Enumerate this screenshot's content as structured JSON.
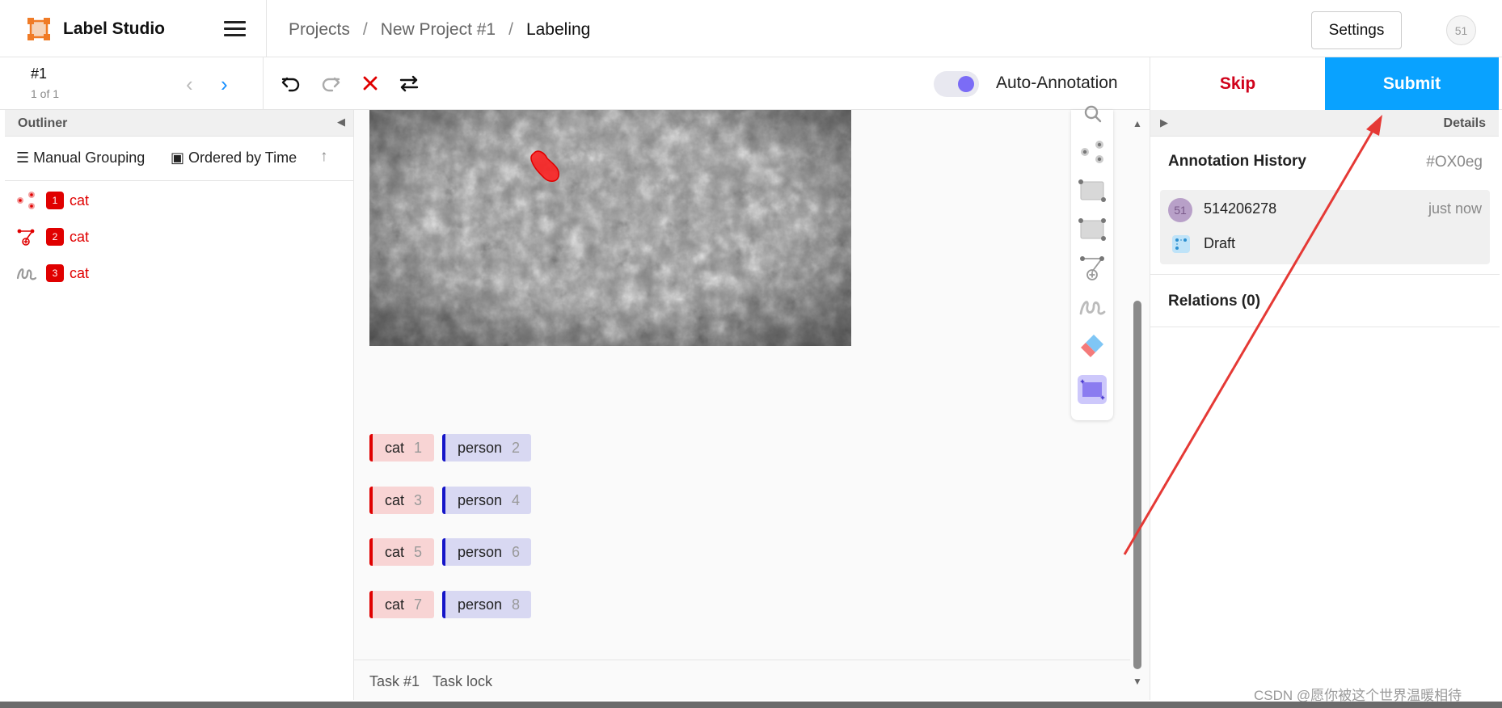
{
  "app": {
    "title": "Label Studio"
  },
  "breadcrumb": {
    "items": [
      "Projects",
      "New Project #1",
      "Labeling"
    ]
  },
  "header": {
    "settings_label": "Settings",
    "avatar_initials": "51"
  },
  "task": {
    "id": "#1",
    "count": "1 of 1"
  },
  "toolbar": {
    "auto_annotation_label": "Auto-Annotation",
    "auto_annotation_on": true
  },
  "actions": {
    "skip_label": "Skip",
    "submit_label": "Submit"
  },
  "outliner": {
    "title": "Outliner",
    "grouping_label": "Manual Grouping",
    "ordering_label": "Ordered by Time",
    "regions": [
      {
        "index": "1",
        "label": "cat",
        "icon": "keypoint-icon"
      },
      {
        "index": "2",
        "label": "cat",
        "icon": "polygon-icon"
      },
      {
        "index": "3",
        "label": "cat",
        "icon": "brush-icon"
      }
    ]
  },
  "labels": [
    {
      "name": "cat",
      "hotkey": "1"
    },
    {
      "name": "person",
      "hotkey": "2"
    },
    {
      "name": "cat",
      "hotkey": "3"
    },
    {
      "name": "person",
      "hotkey": "4"
    },
    {
      "name": "cat",
      "hotkey": "5"
    },
    {
      "name": "person",
      "hotkey": "6"
    },
    {
      "name": "cat",
      "hotkey": "7"
    },
    {
      "name": "person",
      "hotkey": "8"
    }
  ],
  "footer": {
    "task_label": "Task #1",
    "lock_label": "Task lock"
  },
  "details": {
    "title": "Details",
    "history_title": "Annotation History",
    "history_id": "#OX0eg",
    "entry": {
      "avatar": "51",
      "user": "514206278",
      "time": "just now",
      "status": "Draft"
    },
    "relations_label": "Relations (0)"
  },
  "watermark": "CSDN @愿你被这个世界温暖相待",
  "colors": {
    "accent": "#09a2ff",
    "cat": "#e00000",
    "person": "#1515c8",
    "skip": "#d0021b",
    "toggle": "#7b6cf6",
    "arrow": "#e53935"
  }
}
